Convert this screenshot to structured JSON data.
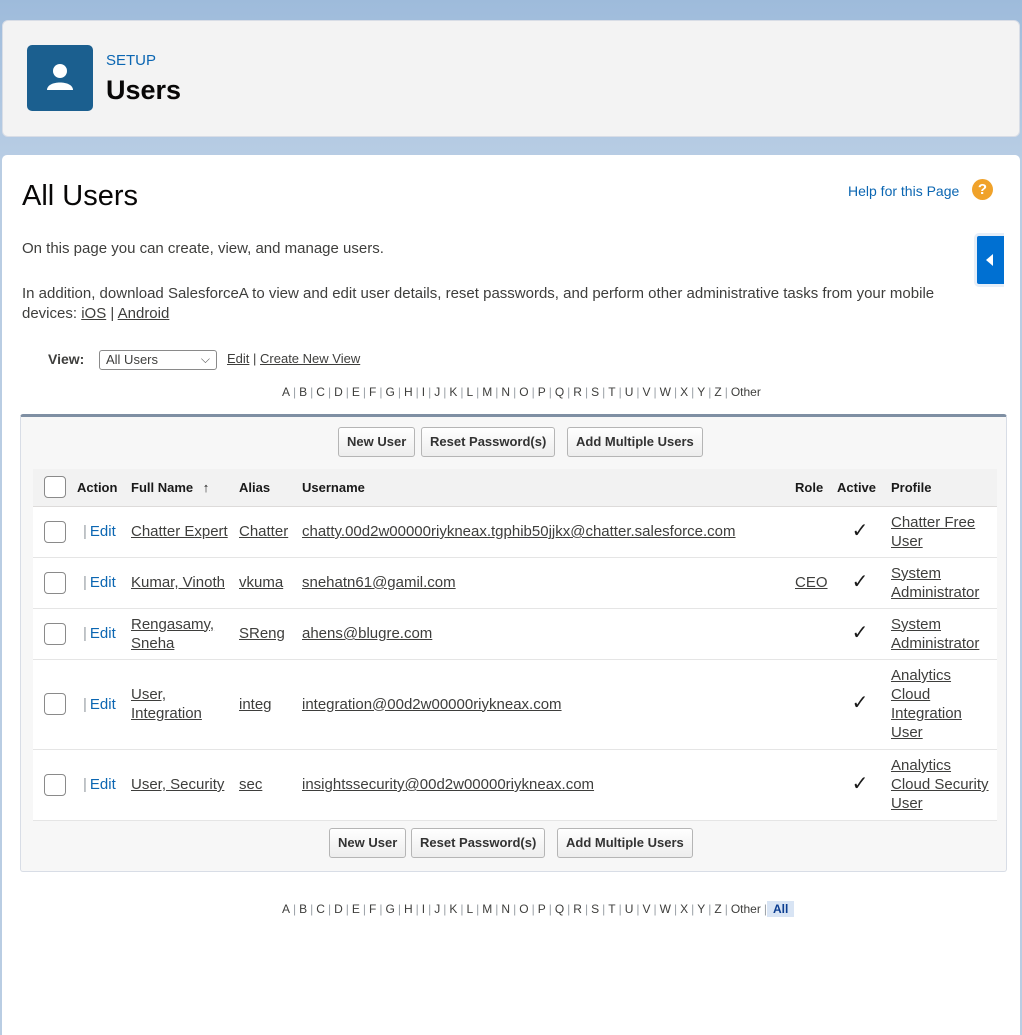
{
  "header": {
    "setup_label": "SETUP",
    "title": "Users"
  },
  "page": {
    "heading": "All Users",
    "help_link": "Help for this Page",
    "intro": "On this page you can create, view, and manage users.",
    "download_text": "In addition, download SalesforceA to view and edit user details, reset passwords, and perform other administrative tasks from your mobile devices: ",
    "ios_link": "iOS",
    "separator": " | ",
    "android_link": "Android"
  },
  "view": {
    "label": "View:",
    "selected": "All Users",
    "edit_link": "Edit",
    "link_sep": " | ",
    "create_link": "Create New View"
  },
  "alphabet": [
    "A",
    "B",
    "C",
    "D",
    "E",
    "F",
    "G",
    "H",
    "I",
    "J",
    "K",
    "L",
    "M",
    "N",
    "O",
    "P",
    "Q",
    "R",
    "S",
    "T",
    "U",
    "V",
    "W",
    "X",
    "Y",
    "Z",
    "Other",
    "All"
  ],
  "alphabet_selected": "All",
  "buttons": {
    "new_user": "New User",
    "reset_password": "Reset Password(s)",
    "add_multiple": "Add Multiple Users"
  },
  "table": {
    "columns": [
      "Action",
      "Full Name",
      "Alias",
      "Username",
      "Role",
      "Active",
      "Profile"
    ],
    "sort_indicator": "↑",
    "edit_label": "Edit",
    "rows": [
      {
        "full_name": "Chatter Expert",
        "alias": "Chatter",
        "username": "chatty.00d2w00000riykneax.tgphib50jjkx@chatter.salesforce.com",
        "role": "",
        "active": "✓",
        "profile": "Chatter Free User"
      },
      {
        "full_name": "Kumar, Vinoth",
        "alias": "vkuma",
        "username": "snehatn61@gamil.com",
        "role": "CEO",
        "active": "✓",
        "profile": "System Administrator"
      },
      {
        "full_name": "Rengasamy, Sneha",
        "alias": "SReng",
        "username": "ahens@blugre.com",
        "role": "",
        "active": "✓",
        "profile": "System Administrator"
      },
      {
        "full_name": "User, Integration",
        "alias": "integ",
        "username": "integration@00d2w00000riykneax.com",
        "role": "",
        "active": "✓",
        "profile": "Analytics Cloud Integration User"
      },
      {
        "full_name": "User, Security",
        "alias": "sec",
        "username": "insightssecurity@00d2w00000riykneax.com",
        "role": "",
        "active": "✓",
        "profile": "Analytics Cloud Security User"
      }
    ]
  }
}
